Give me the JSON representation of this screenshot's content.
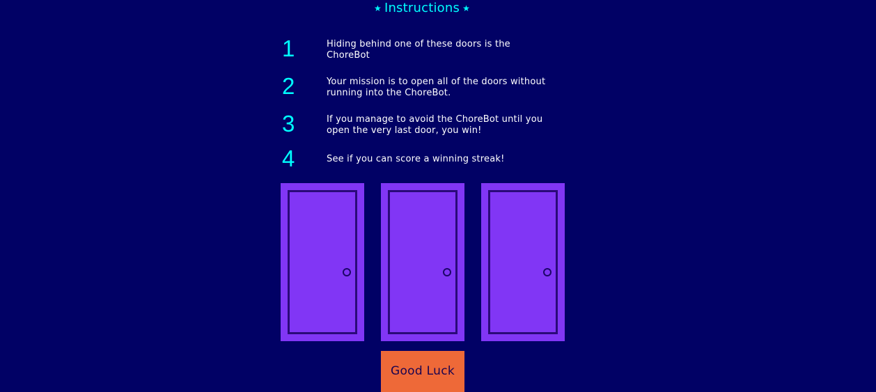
{
  "header": {
    "title": "Instructions",
    "star_left": "★",
    "star_right": "★"
  },
  "instructions": [
    {
      "number": "1",
      "text": "Hiding behind one of these doors is the ChoreBot"
    },
    {
      "number": "2",
      "text": "Your mission is to open all of the doors without running into the ChoreBot."
    },
    {
      "number": "3",
      "text": "If you manage to avoid the ChoreBot until you open the very last door, you win!"
    },
    {
      "number": "4",
      "text": "See if you can score a winning streak!"
    }
  ],
  "doors": {
    "count": 3,
    "color": "#8136f5",
    "outline_color": "#2b0a79"
  },
  "start_button": {
    "label": "Good Luck",
    "color": "#ee6938"
  },
  "colors": {
    "background": "#010165",
    "accent": "#00ffff",
    "text": "#ffffff"
  }
}
